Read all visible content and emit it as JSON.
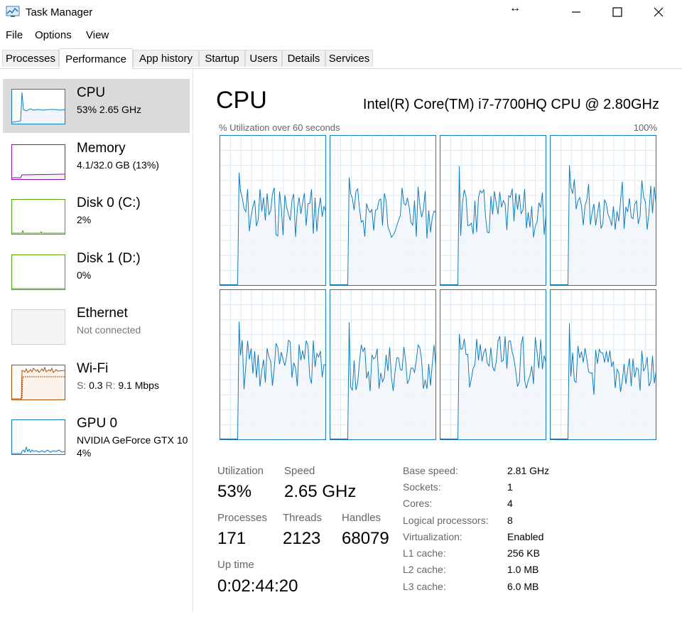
{
  "window": {
    "title": "Task Manager",
    "icon": "task-manager-icon",
    "resize_glyph": "↔"
  },
  "menu": [
    "File",
    "Options",
    "View"
  ],
  "tabs": [
    "Processes",
    "Performance",
    "App history",
    "Startup",
    "Users",
    "Details",
    "Services"
  ],
  "active_tab": "Performance",
  "sidebar": {
    "items": [
      {
        "name": "CPU",
        "sub1": "53% 2.65 GHz",
        "sub2": "",
        "color": "#117dbb"
      },
      {
        "name": "Memory",
        "sub1": "4.1/32.0 GB (13%)",
        "sub2": "",
        "color": "#8b12ae"
      },
      {
        "name": "Disk 0 (C:)",
        "sub1": "2%",
        "sub2": "",
        "color": "#4da60c"
      },
      {
        "name": "Disk 1 (D:)",
        "sub1": "0%",
        "sub2": "",
        "color": "#4da60c"
      },
      {
        "name": "Ethernet",
        "sub1": "Not connected",
        "sub2": "",
        "color": "#d0d0d0"
      },
      {
        "name": "Wi-Fi",
        "sub1_s_label": "S:",
        "sub1_s_val": "0.3",
        "sub1_r_label": "R:",
        "sub1_r_val": "9.1 Mbps",
        "color": "#a74f01"
      },
      {
        "name": "GPU 0",
        "sub1": "NVIDIA GeForce GTX 10",
        "sub2": "4%",
        "color": "#117dbb"
      }
    ]
  },
  "main": {
    "title": "CPU",
    "model": "Intel(R) Core(TM) i7-7700HQ CPU @ 2.80GHz",
    "graph_label": "% Utilization over 60 seconds",
    "graph_max": "100%",
    "graph_color": "#117dbb",
    "core_count": 8,
    "stats": {
      "utilization_label": "Utilization",
      "utilization": "53%",
      "speed_label": "Speed",
      "speed": "2.65 GHz",
      "processes_label": "Processes",
      "processes": "171",
      "threads_label": "Threads",
      "threads": "2123",
      "handles_label": "Handles",
      "handles": "68079",
      "uptime_label": "Up time",
      "uptime": "0:02:44:20"
    },
    "info": [
      {
        "label": "Base speed:",
        "value": "2.81 GHz"
      },
      {
        "label": "Sockets:",
        "value": "1"
      },
      {
        "label": "Cores:",
        "value": "4"
      },
      {
        "label": "Logical processors:",
        "value": "8"
      },
      {
        "label": "Virtualization:",
        "value": "Enabled"
      },
      {
        "label": "L1 cache:",
        "value": "256 KB"
      },
      {
        "label": "L2 cache:",
        "value": "1.0 MB"
      },
      {
        "label": "L3 cache:",
        "value": "6.0 MB"
      }
    ]
  }
}
